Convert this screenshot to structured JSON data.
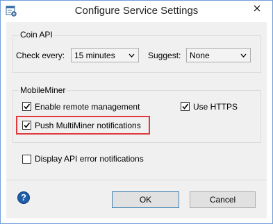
{
  "window": {
    "title": "Configure Service Settings",
    "close_glyph": "✕"
  },
  "coin_api": {
    "group_label": "Coin API",
    "check_every_label": "Check every:",
    "check_every_value": "15 minutes",
    "suggest_label": "Suggest:",
    "suggest_value": "None"
  },
  "mobile_miner": {
    "group_label": "MobileMiner",
    "enable_remote": {
      "label": "Enable remote management",
      "checked": true
    },
    "use_https": {
      "label": "Use HTTPS",
      "checked": true
    },
    "push_notifications": {
      "label": "Push MultiMiner notifications",
      "checked": true
    }
  },
  "display_api_errors": {
    "label": "Display API error notifications",
    "checked": false
  },
  "footer": {
    "help_glyph": "?",
    "ok_label": "OK",
    "cancel_label": "Cancel"
  },
  "colors": {
    "highlight": "#e0393e",
    "accent": "#1f5ea8"
  },
  "icons": [
    "settings-window-icon",
    "close-icon",
    "chevron-down-icon",
    "checkmark-icon",
    "help-icon"
  ]
}
